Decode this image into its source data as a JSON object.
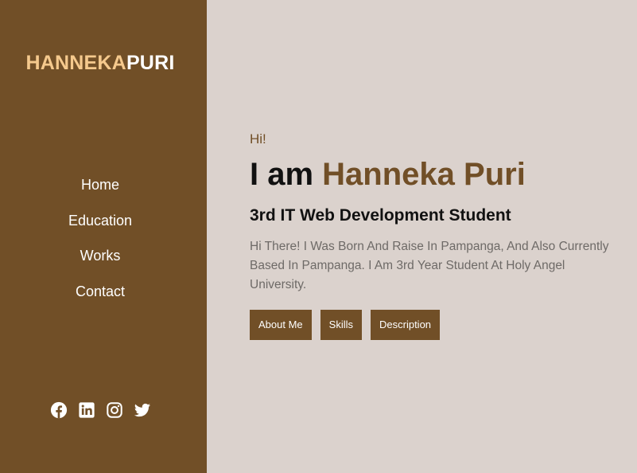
{
  "brand": {
    "part1": "HANNEKA",
    "part2": "PURI"
  },
  "nav": {
    "items": [
      {
        "label": "Home"
      },
      {
        "label": "Education"
      },
      {
        "label": "Works"
      },
      {
        "label": "Contact"
      }
    ]
  },
  "social": [
    "facebook-icon",
    "linkedin-icon",
    "instagram-icon",
    "twitter-icon"
  ],
  "hero": {
    "greeting": "Hi!",
    "headline_prefix": "I am ",
    "headline_name": "Hanneka Puri",
    "role": "3rd IT Web Development Student",
    "description": "Hi There! I Was Born And Raise In Pampanga, And Also Currently Based In Pampanga. I Am 3rd Year Student At Holy Angel University.",
    "buttons": [
      {
        "label": "About Me"
      },
      {
        "label": "Skills"
      },
      {
        "label": "Description"
      }
    ]
  },
  "colors": {
    "sidebar": "#714f27",
    "background": "#dbd2cd",
    "brand_accent": "#f5c98d",
    "accent": "#714f27"
  }
}
